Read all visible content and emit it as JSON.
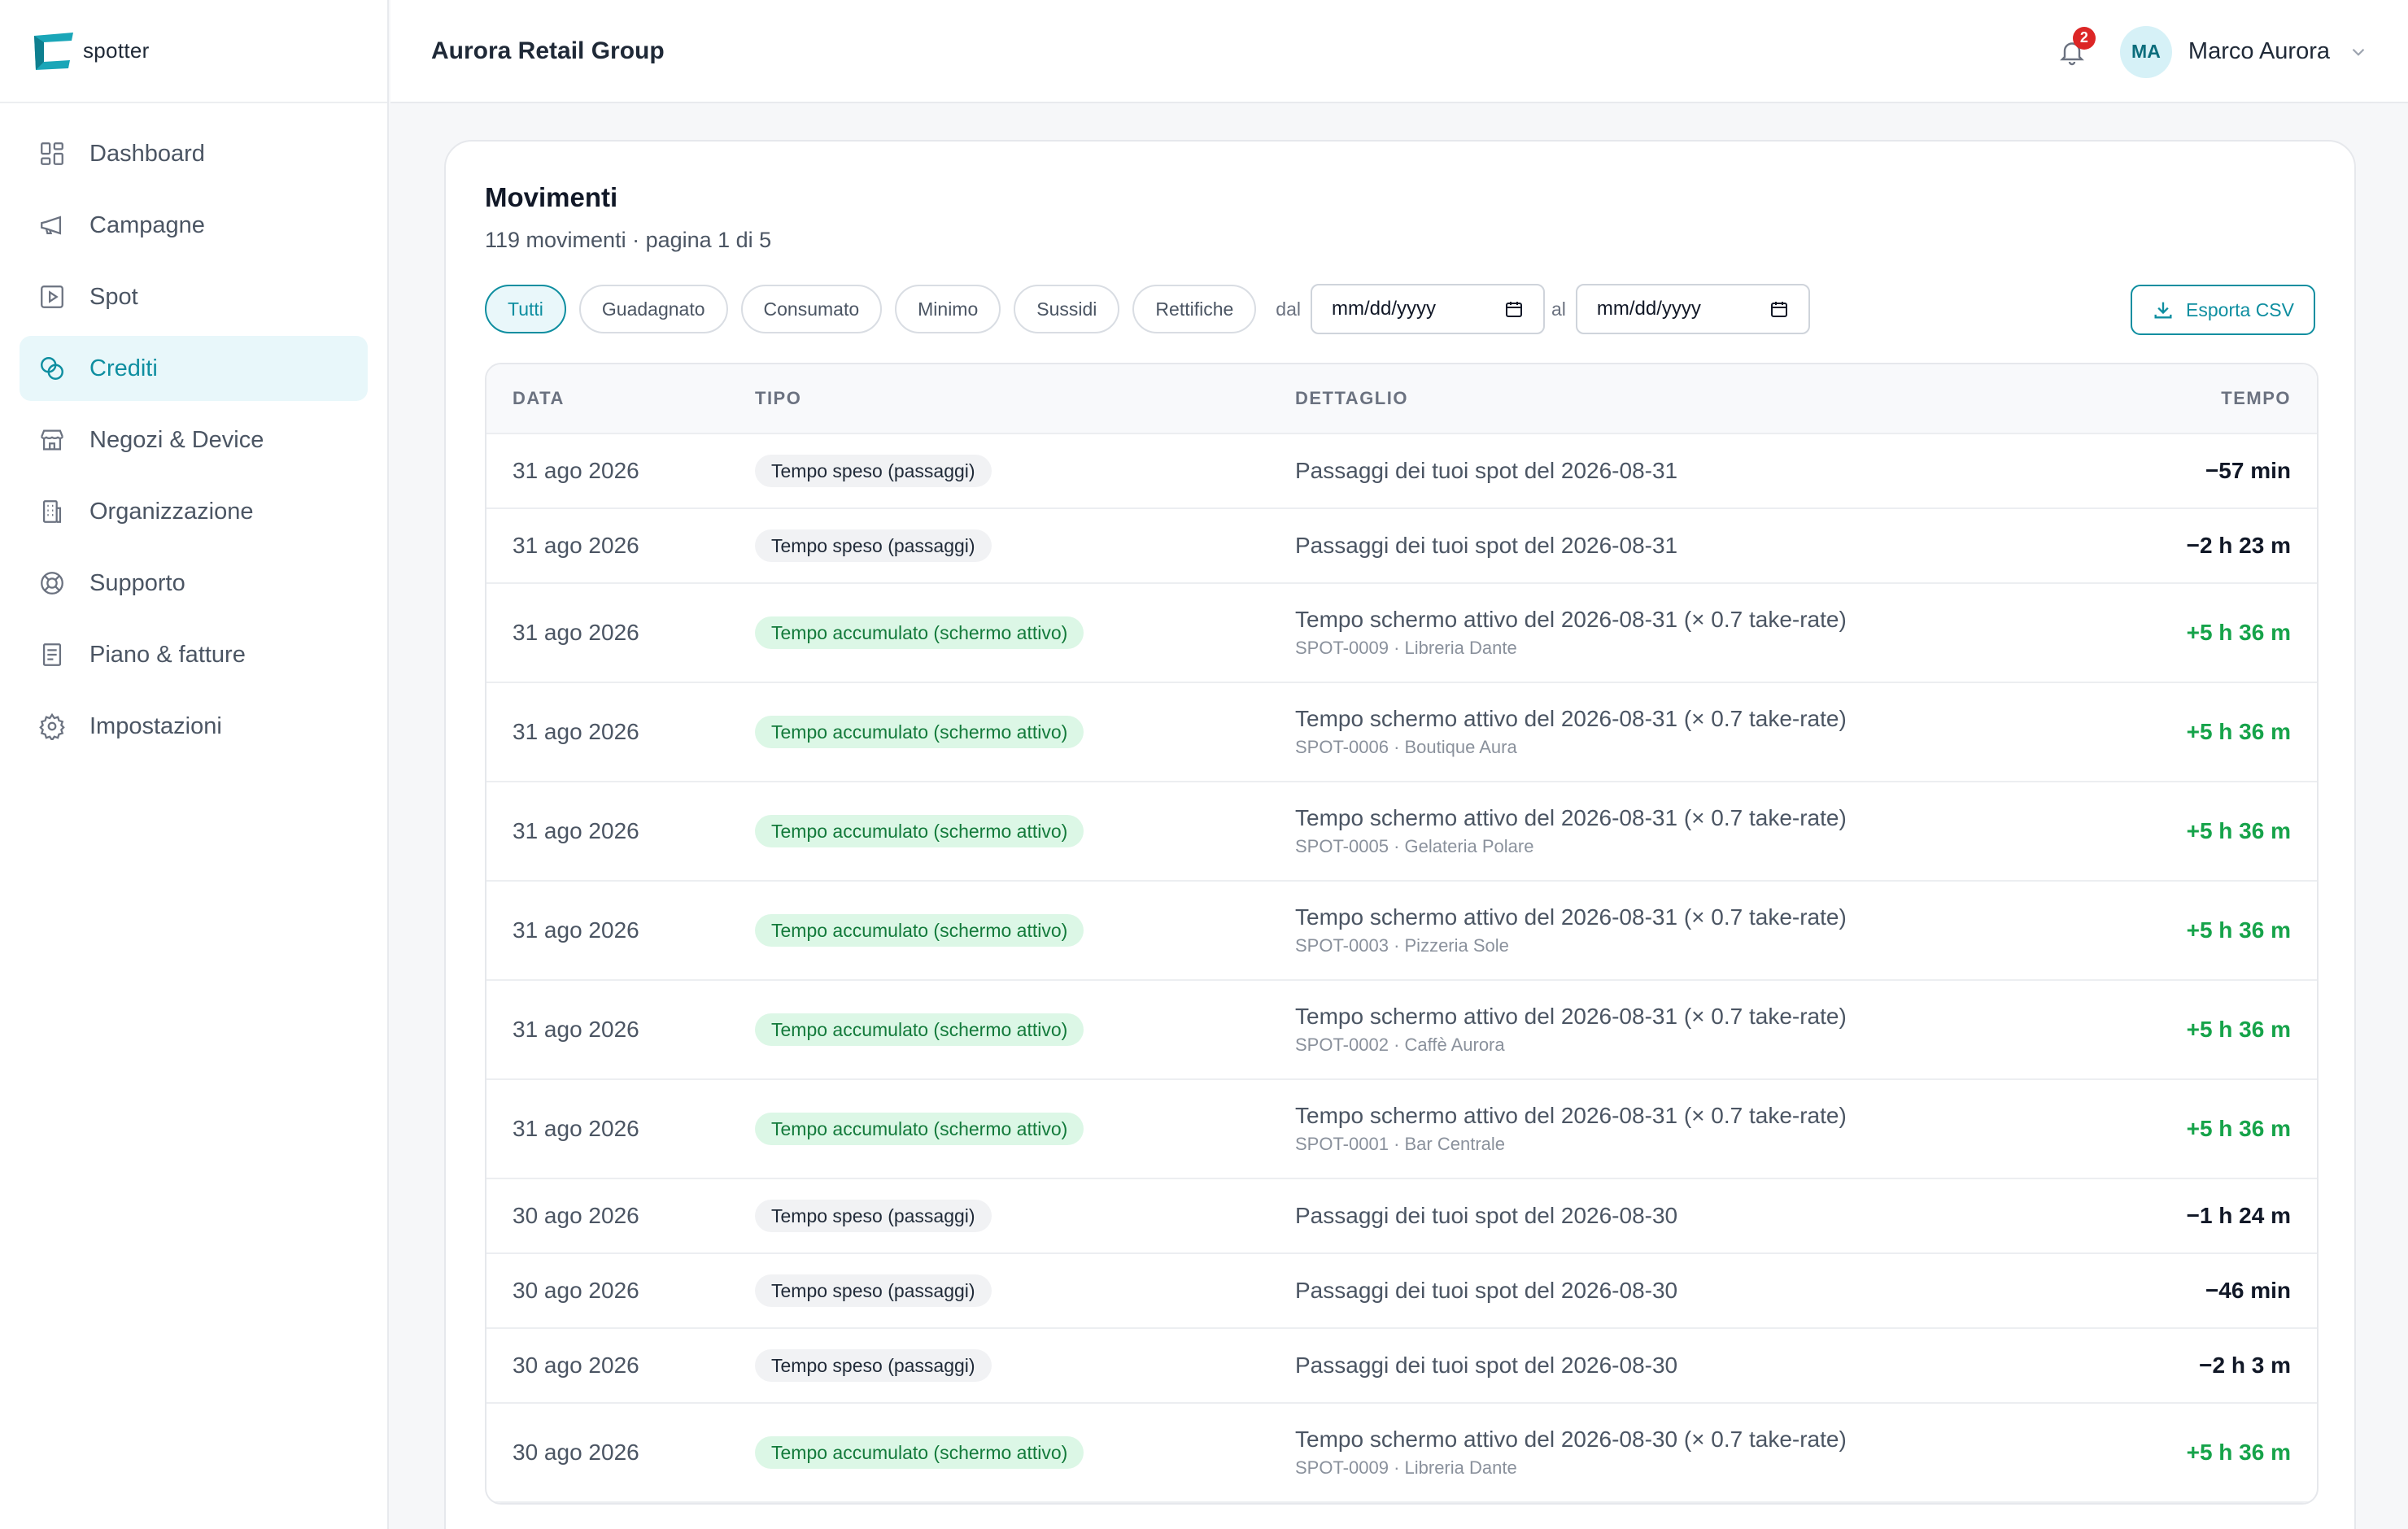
{
  "brand": {
    "name": "spotter",
    "logo_icon": "spotter-logo-icon",
    "accent": "#0e8ea0"
  },
  "sidebar": {
    "items": [
      {
        "label": "Dashboard",
        "icon": "grid-icon",
        "active": false
      },
      {
        "label": "Campagne",
        "icon": "megaphone-icon",
        "active": false
      },
      {
        "label": "Spot",
        "icon": "play-square-icon",
        "active": false
      },
      {
        "label": "Crediti",
        "icon": "coins-icon",
        "active": true
      },
      {
        "label": "Negozi & Device",
        "icon": "store-icon",
        "active": false
      },
      {
        "label": "Organizzazione",
        "icon": "building-icon",
        "active": false
      },
      {
        "label": "Supporto",
        "icon": "lifebuoy-icon",
        "active": false
      },
      {
        "label": "Piano & fatture",
        "icon": "document-icon",
        "active": false
      },
      {
        "label": "Impostazioni",
        "icon": "gear-icon",
        "active": false
      }
    ]
  },
  "header": {
    "org_name": "Aurora Retail Group",
    "notifications_count": "2",
    "user_initials": "MA",
    "user_name": "Marco Aurora"
  },
  "card": {
    "title": "Movimenti",
    "subtitle": "119 movimenti · pagina 1 di 5",
    "filters": [
      {
        "label": "Tutti",
        "active": true
      },
      {
        "label": "Guadagnato",
        "active": false
      },
      {
        "label": "Consumato",
        "active": false
      },
      {
        "label": "Minimo",
        "active": false
      },
      {
        "label": "Sussidi",
        "active": false
      },
      {
        "label": "Rettifiche",
        "active": false
      }
    ],
    "date_from_label": "dal",
    "date_from_placeholder": "mm/dd/yyyy",
    "date_to_label": "al",
    "date_to_placeholder": "mm/dd/yyyy",
    "export_label": "Esporta CSV"
  },
  "table": {
    "headers": {
      "data": "DATA",
      "tipo": "TIPO",
      "dettaglio": "DETTAGLIO",
      "tempo": "TEMPO"
    },
    "rows": [
      {
        "date": "31 ago 2026",
        "type": "Tempo speso (passaggi)",
        "kind": "speso",
        "detail": "Passaggi dei tuoi spot del 2026-08-31",
        "sub": "",
        "tempo": "−57 min",
        "sign": "neg"
      },
      {
        "date": "31 ago 2026",
        "type": "Tempo speso (passaggi)",
        "kind": "speso",
        "detail": "Passaggi dei tuoi spot del 2026-08-31",
        "sub": "",
        "tempo": "−2 h 23 m",
        "sign": "neg"
      },
      {
        "date": "31 ago 2026",
        "type": "Tempo accumulato (schermo attivo)",
        "kind": "accum",
        "detail": "Tempo schermo attivo del 2026-08-31 (× 0.7 take-rate)",
        "sub": "SPOT-0009 · Libreria Dante",
        "tempo": "+5 h 36 m",
        "sign": "pos"
      },
      {
        "date": "31 ago 2026",
        "type": "Tempo accumulato (schermo attivo)",
        "kind": "accum",
        "detail": "Tempo schermo attivo del 2026-08-31 (× 0.7 take-rate)",
        "sub": "SPOT-0006 · Boutique Aura",
        "tempo": "+5 h 36 m",
        "sign": "pos"
      },
      {
        "date": "31 ago 2026",
        "type": "Tempo accumulato (schermo attivo)",
        "kind": "accum",
        "detail": "Tempo schermo attivo del 2026-08-31 (× 0.7 take-rate)",
        "sub": "SPOT-0005 · Gelateria Polare",
        "tempo": "+5 h 36 m",
        "sign": "pos"
      },
      {
        "date": "31 ago 2026",
        "type": "Tempo accumulato (schermo attivo)",
        "kind": "accum",
        "detail": "Tempo schermo attivo del 2026-08-31 (× 0.7 take-rate)",
        "sub": "SPOT-0003 · Pizzeria Sole",
        "tempo": "+5 h 36 m",
        "sign": "pos"
      },
      {
        "date": "31 ago 2026",
        "type": "Tempo accumulato (schermo attivo)",
        "kind": "accum",
        "detail": "Tempo schermo attivo del 2026-08-31 (× 0.7 take-rate)",
        "sub": "SPOT-0002 · Caffè Aurora",
        "tempo": "+5 h 36 m",
        "sign": "pos"
      },
      {
        "date": "31 ago 2026",
        "type": "Tempo accumulato (schermo attivo)",
        "kind": "accum",
        "detail": "Tempo schermo attivo del 2026-08-31 (× 0.7 take-rate)",
        "sub": "SPOT-0001 · Bar Centrale",
        "tempo": "+5 h 36 m",
        "sign": "pos"
      },
      {
        "date": "30 ago 2026",
        "type": "Tempo speso (passaggi)",
        "kind": "speso",
        "detail": "Passaggi dei tuoi spot del 2026-08-30",
        "sub": "",
        "tempo": "−1 h 24 m",
        "sign": "neg"
      },
      {
        "date": "30 ago 2026",
        "type": "Tempo speso (passaggi)",
        "kind": "speso",
        "detail": "Passaggi dei tuoi spot del 2026-08-30",
        "sub": "",
        "tempo": "−46 min",
        "sign": "neg"
      },
      {
        "date": "30 ago 2026",
        "type": "Tempo speso (passaggi)",
        "kind": "speso",
        "detail": "Passaggi dei tuoi spot del 2026-08-30",
        "sub": "",
        "tempo": "−2 h 3 m",
        "sign": "neg"
      },
      {
        "date": "30 ago 2026",
        "type": "Tempo accumulato (schermo attivo)",
        "kind": "accum",
        "detail": "Tempo schermo attivo del 2026-08-30 (× 0.7 take-rate)",
        "sub": "SPOT-0009 · Libreria Dante",
        "tempo": "+5 h 36 m",
        "sign": "pos"
      }
    ]
  }
}
